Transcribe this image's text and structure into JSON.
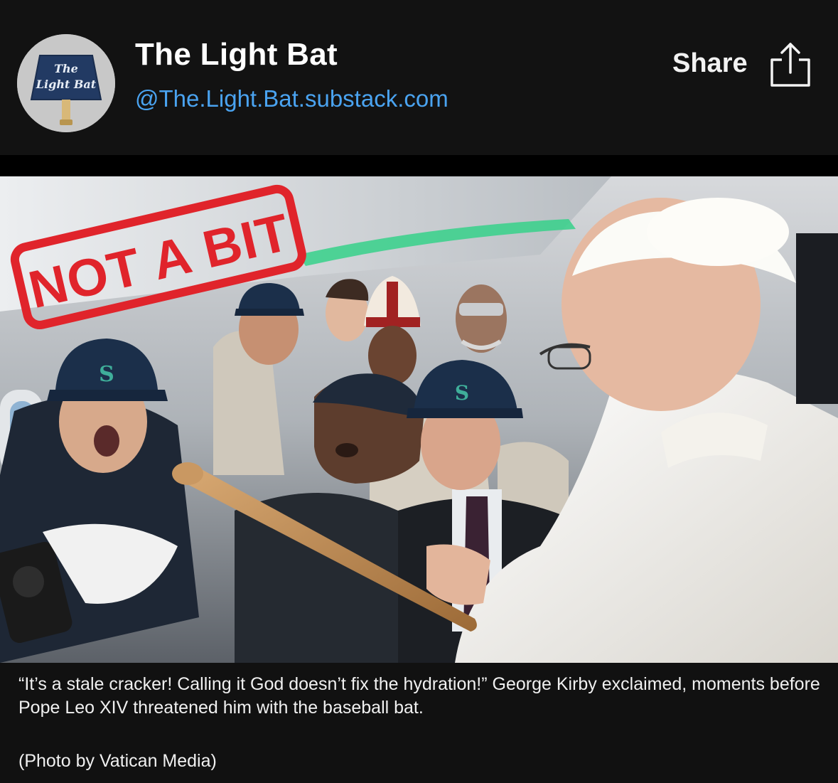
{
  "publication": {
    "name": "The Light Bat",
    "handle": "@The.Light.Bat.substack.com",
    "logo": {
      "line1": "The",
      "line2": "Light Bat"
    }
  },
  "share": {
    "label": "Share",
    "icon": "share-upload-icon"
  },
  "photo": {
    "stamp_text": "NOT A BIT",
    "icon": "photo-image"
  },
  "caption": {
    "text": "“It’s a stale cracker! Calling it God doesn’t fix the hydration!” George Kirby exclaimed, moments before Pope Leo XIV threatened him with the baseball bat.",
    "credit": "(Photo by Vatican Media)"
  },
  "colors": {
    "header_bg": "#121212",
    "handle_blue": "#4aa3f0",
    "stamp_red": "#e0242b",
    "caption_bg": "#111111"
  }
}
